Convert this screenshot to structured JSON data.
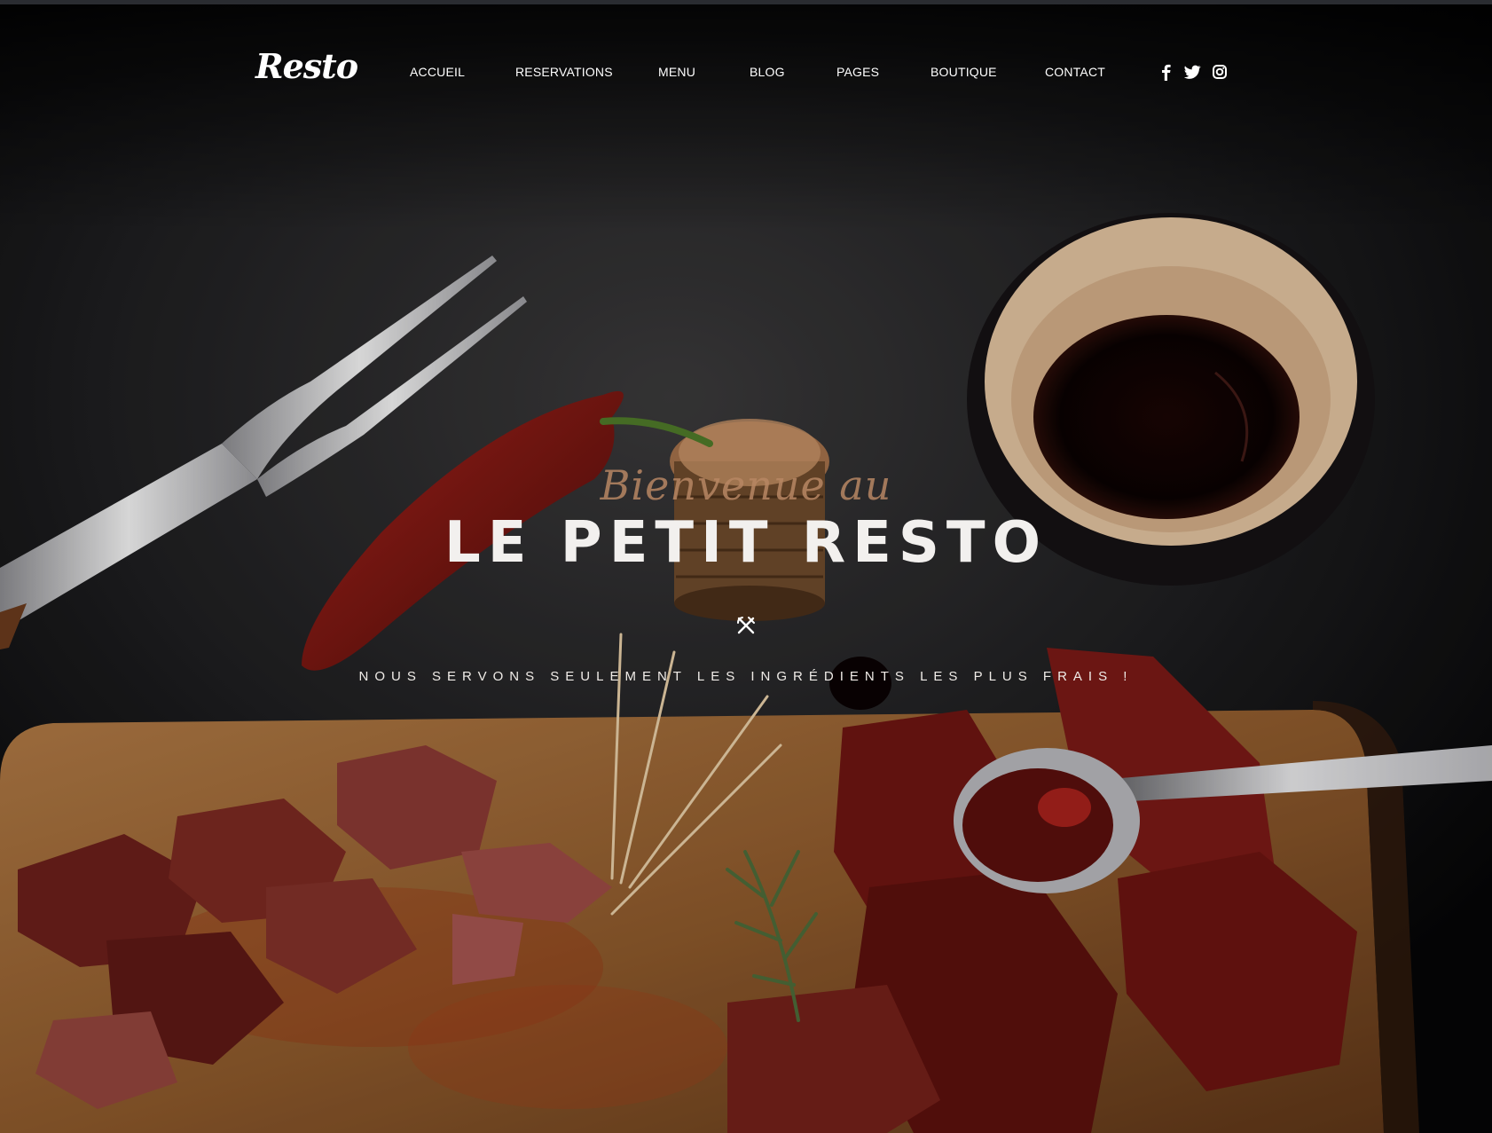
{
  "brand": {
    "logo_text": "Resto"
  },
  "nav": {
    "items": [
      {
        "label": "ACCUEIL"
      },
      {
        "label": "RESERVATIONS"
      },
      {
        "label": "MENU"
      },
      {
        "label": "BLOG"
      },
      {
        "label": "PAGES"
      },
      {
        "label": "BOUTIQUE"
      },
      {
        "label": "CONTACT"
      }
    ],
    "social": [
      {
        "icon": "facebook-icon"
      },
      {
        "icon": "twitter-icon"
      },
      {
        "icon": "instagram-icon"
      }
    ]
  },
  "hero": {
    "script_text": "Bienvenue au",
    "title": "LE PETIT RESTO",
    "divider_icon": "fork-knife-icon",
    "tagline": "NOUS SERVONS SEULEMENT LES INGRÉDIENTS LES PLUS FRAIS !"
  },
  "colors": {
    "background": "#0b0b0c",
    "accent_script": "#b88764",
    "text": "#ffffff"
  }
}
